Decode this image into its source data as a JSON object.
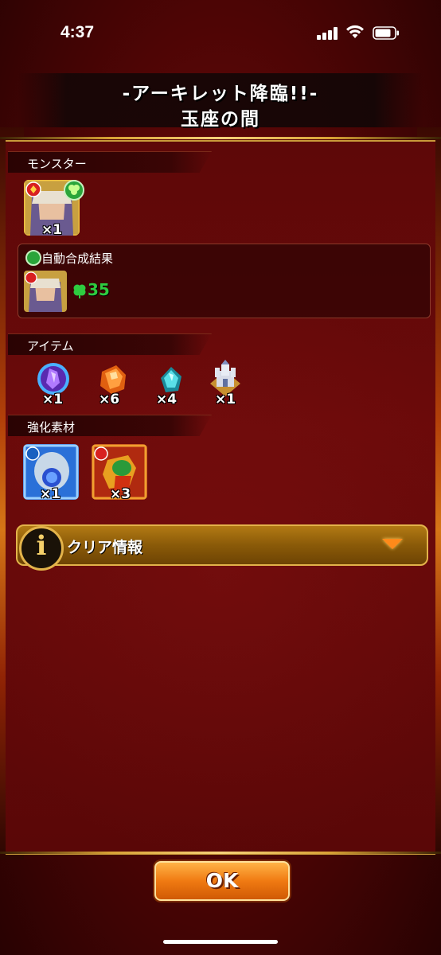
{
  "status_bar": {
    "time": "4:37"
  },
  "header": {
    "title": "-アーキレット降臨!!-",
    "subtitle": "玉座の間"
  },
  "monster_section": {
    "label": "モンスター",
    "monster": {
      "count": "×1"
    },
    "auto_merge": {
      "label": "自動合成結果",
      "luck_value": "35"
    }
  },
  "item_section": {
    "label": "アイテム",
    "items": [
      {
        "icon": "purple-crystal-icon",
        "count": "×1"
      },
      {
        "icon": "orange-stone-icon",
        "count": "×6"
      },
      {
        "icon": "blue-gem-icon",
        "count": "×4"
      },
      {
        "icon": "castle-icon",
        "count": "×1"
      }
    ]
  },
  "material_section": {
    "label": "強化素材",
    "materials": [
      {
        "icon": "blue-spirit-icon",
        "count": "×1"
      },
      {
        "icon": "green-dragon-icon",
        "count": "×3"
      }
    ]
  },
  "clear_info": {
    "label": "クリア情報"
  },
  "ok_button": {
    "label": "OK"
  },
  "colors": {
    "accent_gold": "#d9a235",
    "panel_red": "#6a0a0a",
    "luck_green": "#2ecc40",
    "ok_orange": "#f07a12"
  }
}
